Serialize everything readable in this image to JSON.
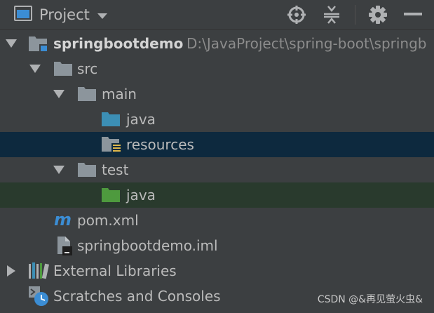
{
  "toolbar": {
    "view_label": "Project",
    "icons": [
      "project-view-icon",
      "dropdown-chevron-icon",
      "locate-crosshair-icon",
      "collapse-all-icon",
      "gear-icon",
      "minimize-icon"
    ]
  },
  "tree": {
    "root": {
      "label": "springbootdemo",
      "path": "D:\\JavaProject\\spring-boot\\springb"
    },
    "src": "src",
    "main": "main",
    "main_java": "java",
    "resources": "resources",
    "test": "test",
    "test_java": "java",
    "pom": "pom.xml",
    "iml": "springbootdemo.iml",
    "external_libraries": "External Libraries",
    "scratches": "Scratches and Consoles"
  },
  "colors": {
    "background": "#3c3f41",
    "selected_row": "#0d293e",
    "highlighted_row": "#293a2d",
    "folder": "#8c959c",
    "source_folder": "#3c8fb5",
    "test_folder": "#4e9a3e",
    "maven_blue": "#3b8dd4"
  },
  "watermark": "CSDN @&再见萤火虫&"
}
